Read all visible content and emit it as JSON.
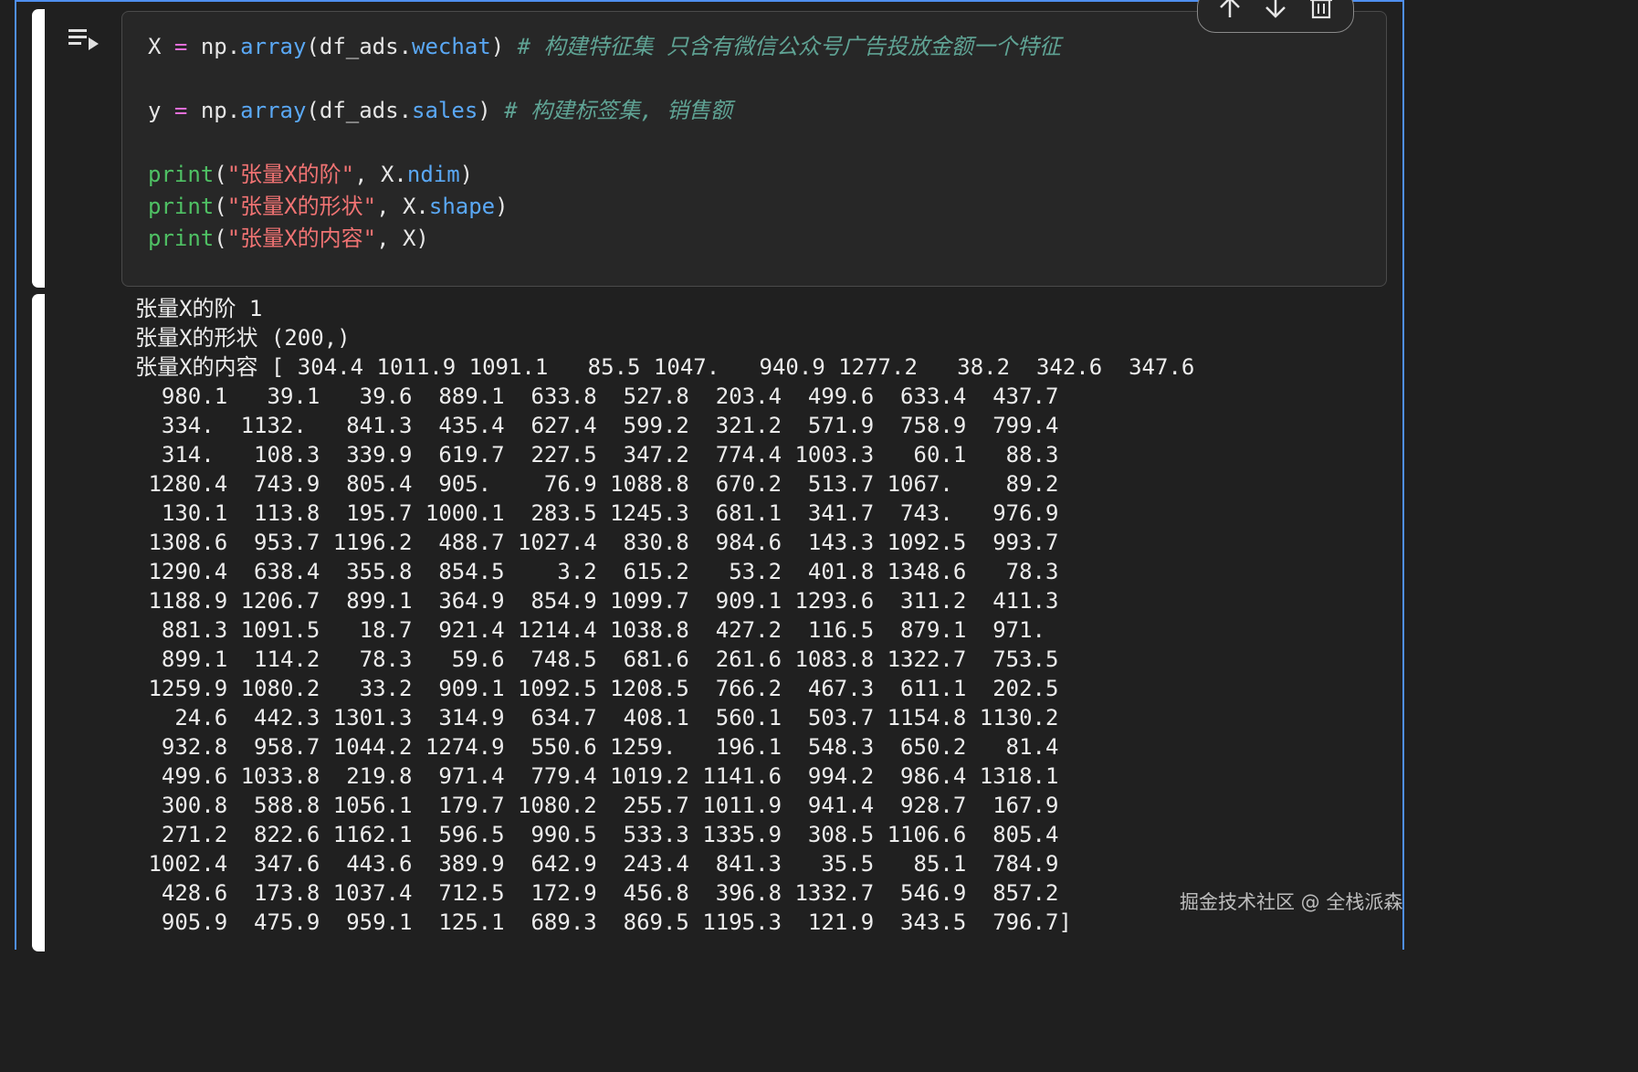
{
  "code": {
    "line1": {
      "var": "X",
      "op": "=",
      "obj": "np",
      "dot": ".",
      "method": "array",
      "open": "(",
      "arg": "df_ads",
      "argdot": ".",
      "attr": "wechat",
      "close": ")",
      "comment": "# 构建特征集 只含有微信公众号广告投放金额一个特征"
    },
    "line2": {
      "var": "y",
      "op": "=",
      "obj": "np",
      "dot": ".",
      "method": "array",
      "open": "(",
      "arg": "df_ads",
      "argdot": ".",
      "attr": "sales",
      "close": ")",
      "comment": "# 构建标签集, 销售额"
    },
    "print_lines": [
      {
        "fn": "print",
        "open": "(",
        "str": "\"张量X的阶\"",
        "sep": ", X",
        "dot": ".",
        "attr": "ndim",
        "close": ")"
      },
      {
        "fn": "print",
        "open": "(",
        "str": "\"张量X的形状\"",
        "sep": ", X",
        "dot": ".",
        "attr": "shape",
        "close": ")"
      },
      {
        "fn": "print",
        "open": "(",
        "str": "\"张量X的内容\"",
        "sep": ", X",
        "dot": "",
        "attr": "",
        "close": ")"
      }
    ]
  },
  "output": {
    "line_ndim": "张量X的阶 1",
    "line_shape": "张量X的形状 (200,)",
    "line_content": "张量X的内容 [ 304.4 1011.9 1091.1   85.5 1047.   940.9 1277.2   38.2  342.6  347.6",
    "rows": [
      "  980.1   39.1   39.6  889.1  633.8  527.8  203.4  499.6  633.4  437.7",
      "  334.  1132.   841.3  435.4  627.4  599.2  321.2  571.9  758.9  799.4",
      "  314.   108.3  339.9  619.7  227.5  347.2  774.4 1003.3   60.1   88.3",
      " 1280.4  743.9  805.4  905.    76.9 1088.8  670.2  513.7 1067.    89.2",
      "  130.1  113.8  195.7 1000.1  283.5 1245.3  681.1  341.7  743.   976.9",
      " 1308.6  953.7 1196.2  488.7 1027.4  830.8  984.6  143.3 1092.5  993.7",
      " 1290.4  638.4  355.8  854.5    3.2  615.2   53.2  401.8 1348.6   78.3",
      " 1188.9 1206.7  899.1  364.9  854.9 1099.7  909.1 1293.6  311.2  411.3",
      "  881.3 1091.5   18.7  921.4 1214.4 1038.8  427.2  116.5  879.1  971.",
      "  899.1  114.2   78.3   59.6  748.5  681.6  261.6 1083.8 1322.7  753.5",
      " 1259.9 1080.2   33.2  909.1 1092.5 1208.5  766.2  467.3  611.1  202.5",
      "   24.6  442.3 1301.3  314.9  634.7  408.1  560.1  503.7 1154.8 1130.2",
      "  932.8  958.7 1044.2 1274.9  550.6 1259.   196.1  548.3  650.2   81.4",
      "  499.6 1033.8  219.8  971.4  779.4 1019.2 1141.6  994.2  986.4 1318.1",
      "  300.8  588.8 1056.1  179.7 1080.2  255.7 1011.9  941.4  928.7  167.9",
      "  271.2  822.6 1162.1  596.5  990.5  533.3 1335.9  308.5 1106.6  805.4",
      " 1002.4  347.6  443.6  389.9  642.9  243.4  841.3   35.5   85.1  784.9",
      "  428.6  173.8 1037.4  712.5  172.9  456.8  396.8 1332.7  546.9  857.2",
      "  905.9  475.9  959.1  125.1  689.3  869.5 1195.3  121.9  343.5  796.7]"
    ]
  },
  "toolbar": {
    "icons": [
      "arrow-up-icon",
      "arrow-down-icon",
      "trash-icon"
    ]
  },
  "watermark": "掘金技术社区 @ 全栈派森",
  "colors": {
    "accent_border": "#4f8ff0",
    "keyword_fn": "#4fc164",
    "string": "#f07373",
    "attribute": "#5aa8f5",
    "operator": "#e46fd8",
    "comment": "#5fa394"
  }
}
